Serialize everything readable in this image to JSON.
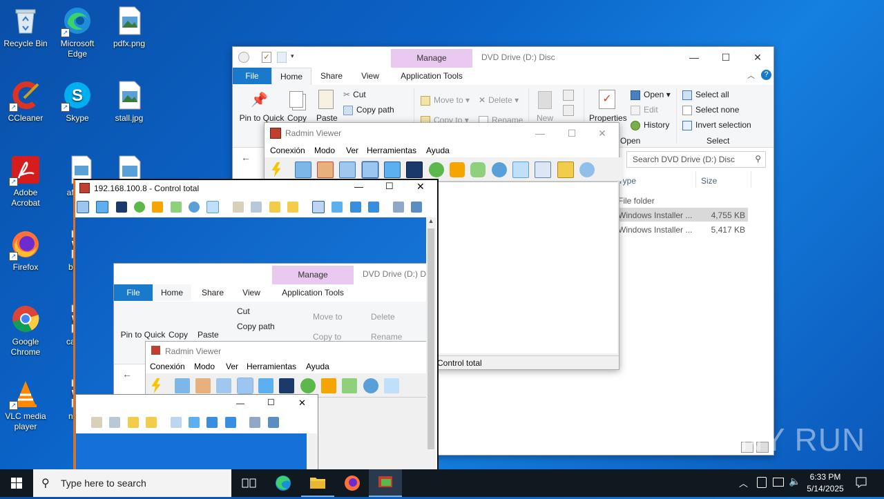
{
  "desktop": {
    "icons": [
      {
        "label": "Recycle Bin"
      },
      {
        "label": "Microsoft Edge"
      },
      {
        "label": "pdfx.png"
      },
      {
        "label": "CCleaner"
      },
      {
        "label": "Skype"
      },
      {
        "label": "stall.jpg"
      },
      {
        "label": "Adobe Acrobat"
      },
      {
        "label": "aftern"
      },
      {
        "label": "Firefox"
      },
      {
        "label": "book"
      },
      {
        "label": "Google Chrome"
      },
      {
        "label": "catalo"
      },
      {
        "label": "VLC media player"
      },
      {
        "label": "neec"
      }
    ]
  },
  "explorer": {
    "title": "DVD Drive (D:) Disc",
    "manage_label": "Manage",
    "tabs": [
      "File",
      "Home",
      "Share",
      "View",
      "Application Tools"
    ],
    "ribbon": {
      "pin": "Pin to Quick access",
      "copy": "Copy",
      "paste": "Paste",
      "cut": "Cut",
      "copy_path": "Copy path",
      "move_to": "Move to",
      "copy_to": "Copy to",
      "delete": "Delete",
      "rename": "Rename",
      "new": "New",
      "properties": "Properties",
      "open": "Open",
      "edit": "Edit",
      "history": "History",
      "open_group": "Open",
      "select_all": "Select all",
      "select_none": "Select none",
      "invert_selection": "Invert selection",
      "select_group": "Select"
    },
    "search_placeholder": "Search DVD Drive (D:) Disc",
    "columns": {
      "type": "Type",
      "size": "Size"
    },
    "rows": [
      {
        "type": "File folder",
        "size": ""
      },
      {
        "type": "Windows Installer ...",
        "size": "4,755 KB"
      },
      {
        "type": "Windows Installer ...",
        "size": "5,417 KB"
      }
    ]
  },
  "radmin": {
    "title": "Radmin Viewer",
    "menu": [
      "Conexión",
      "Modo",
      "Ver",
      "Herramientas",
      "Ayuda"
    ],
    "status": "Control total"
  },
  "remote": {
    "title": "192.168.100.8 - Control total"
  },
  "taskbar": {
    "search_placeholder": "Type here to search",
    "time": "6:33 PM",
    "date": "5/14/2025",
    "colors": {
      "bar": "#101820",
      "accent": "#0078d7"
    }
  },
  "watermark": "ANY RUN"
}
